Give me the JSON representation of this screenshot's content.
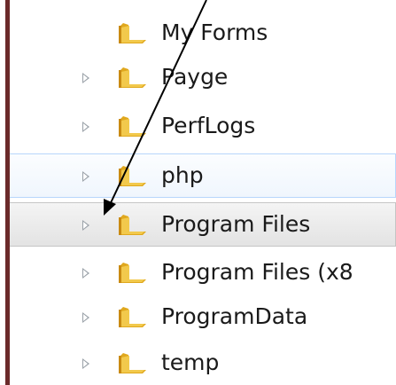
{
  "tree": {
    "items": [
      {
        "label": "My Forms",
        "has_expander": false,
        "state": "normal"
      },
      {
        "label": "Payge",
        "has_expander": true,
        "state": "normal"
      },
      {
        "label": "PerfLogs",
        "has_expander": true,
        "state": "normal"
      },
      {
        "label": "php",
        "has_expander": true,
        "state": "hover"
      },
      {
        "label": "Program Files",
        "has_expander": true,
        "state": "selected"
      },
      {
        "label": "Program Files (x8",
        "has_expander": true,
        "state": "normal"
      },
      {
        "label": "ProgramData",
        "has_expander": true,
        "state": "normal"
      },
      {
        "label": "temp",
        "has_expander": true,
        "state": "normal"
      }
    ]
  },
  "colors": {
    "folder_body": "#f2c94c",
    "folder_tab": "#e0a81e",
    "border": "#6b2a2a",
    "arrow": "#000000"
  },
  "icons": {
    "folder": "folder-icon",
    "expander": "expand-arrow-icon",
    "annotation": "pointer-arrow-annotation"
  }
}
